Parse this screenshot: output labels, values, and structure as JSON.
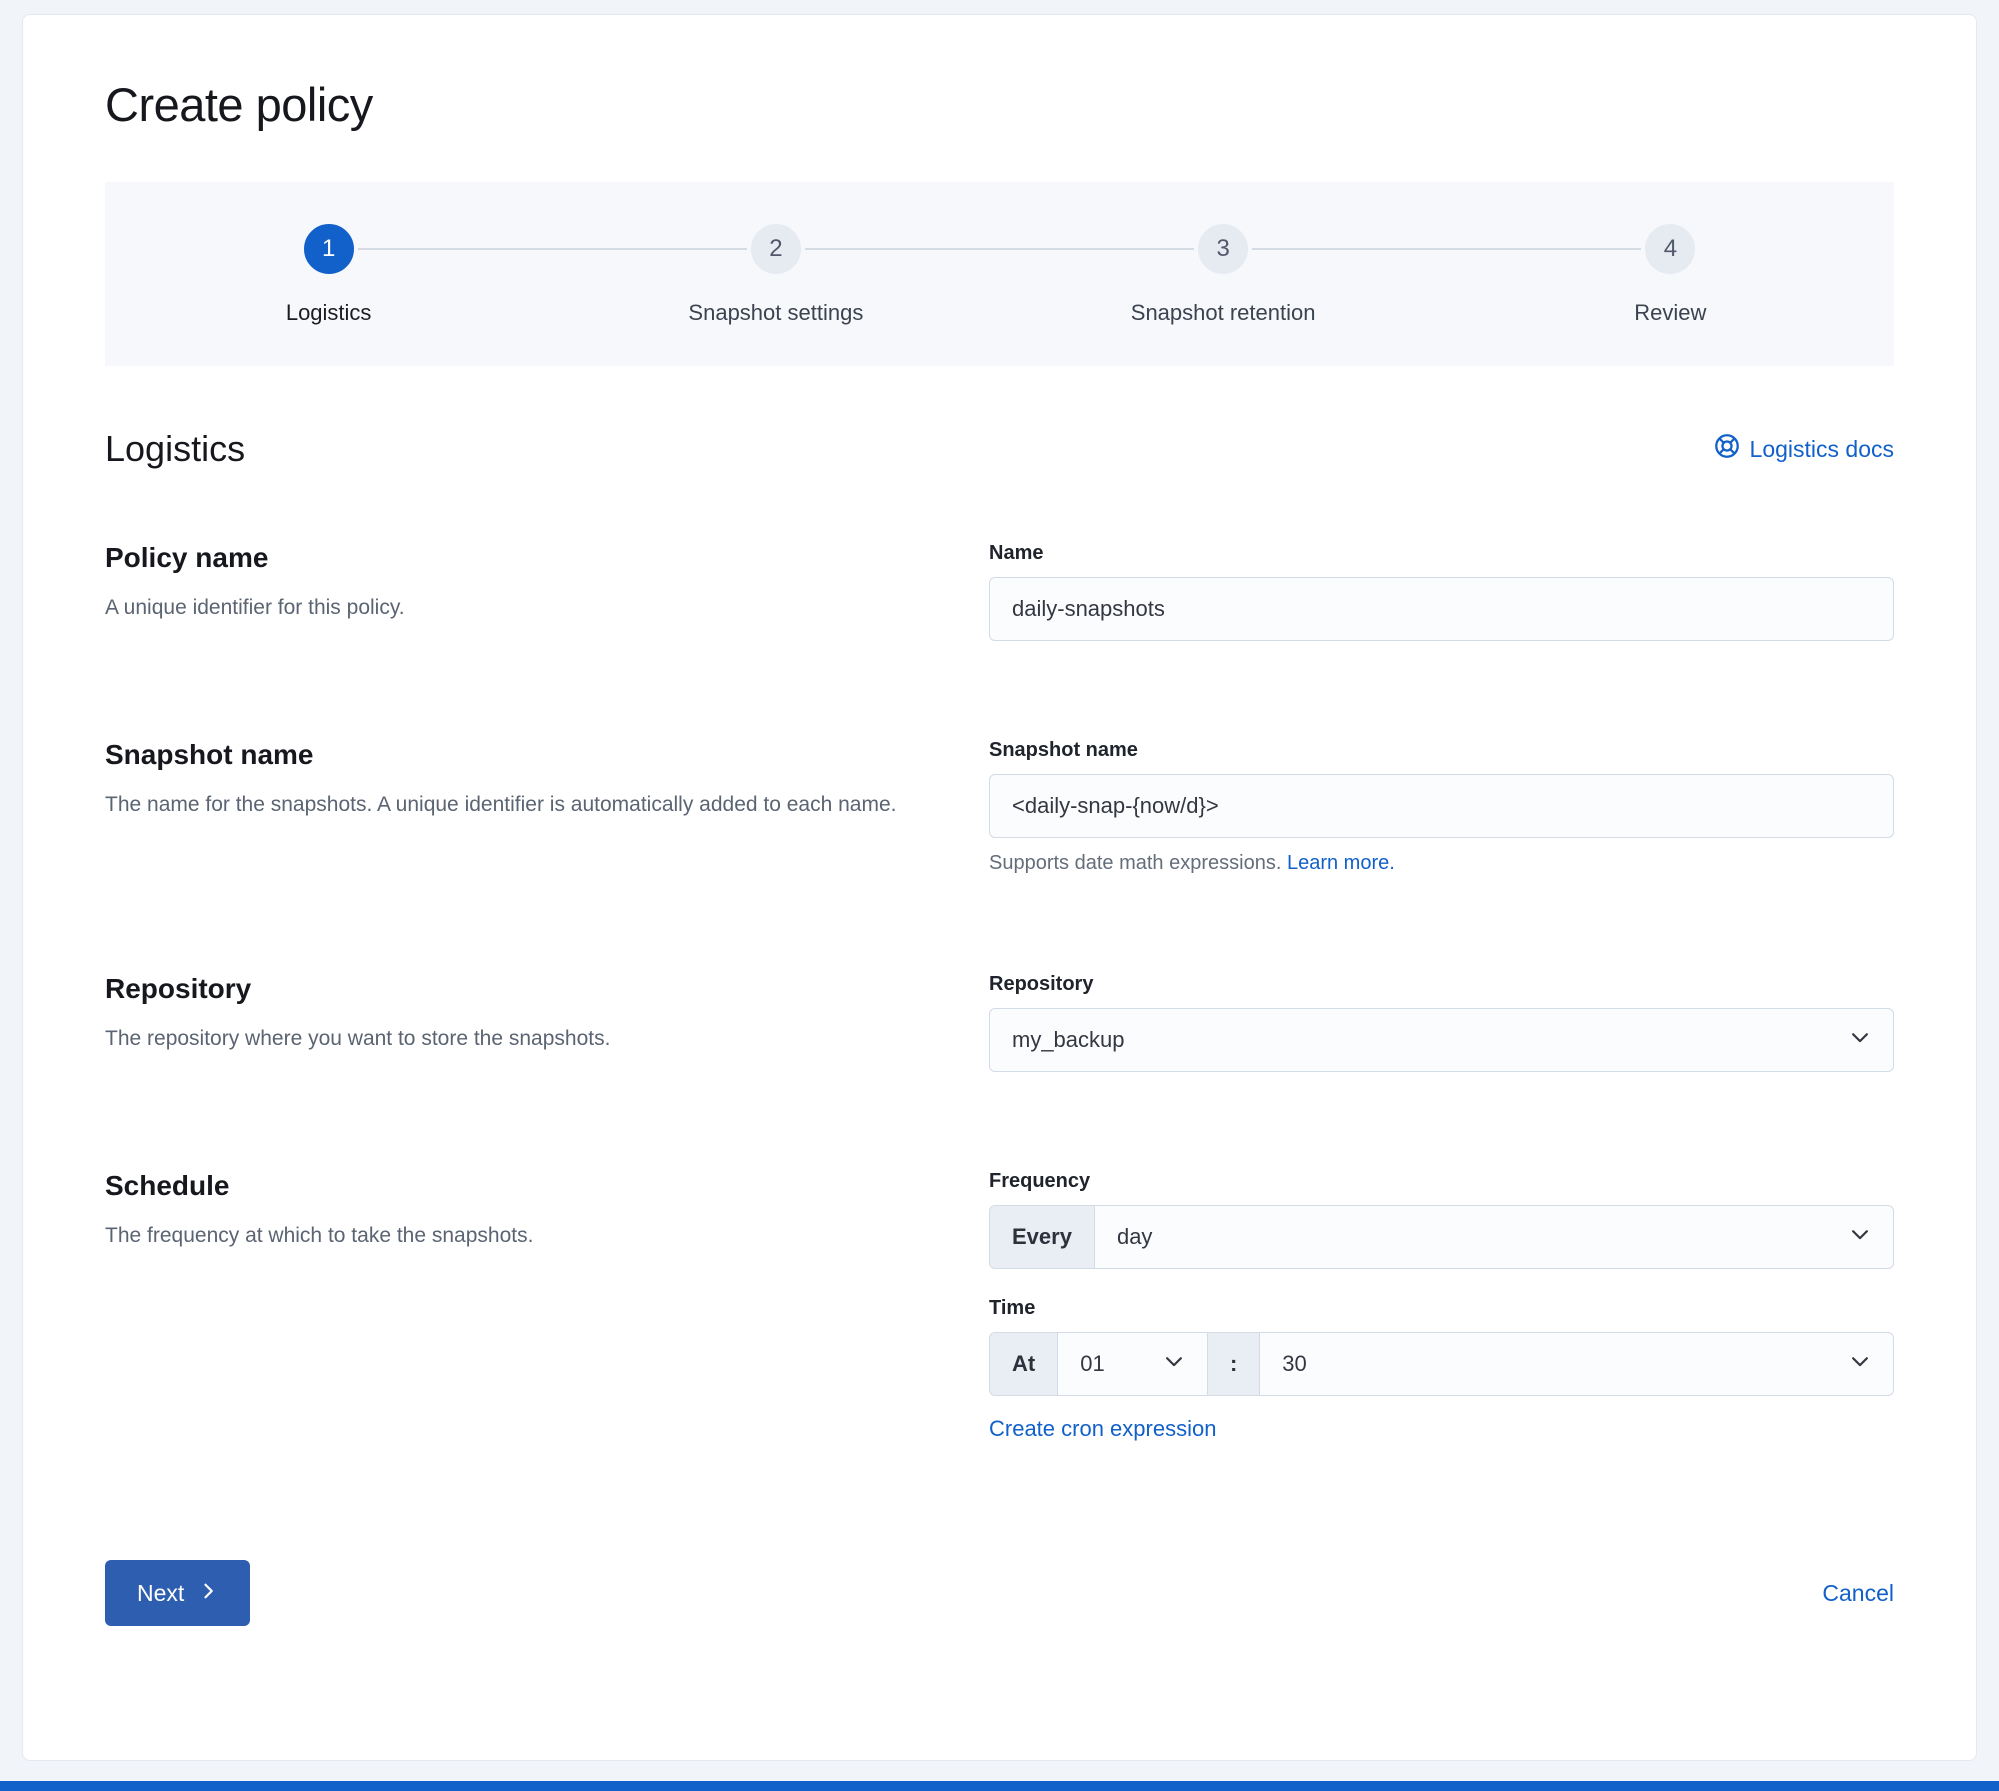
{
  "colors": {
    "accent": "#1260c9",
    "button": "#2e5eb0",
    "page_bg": "#f1f4f9"
  },
  "page": {
    "title": "Create policy"
  },
  "steps": [
    {
      "num": "1",
      "label": "Logistics",
      "state": "active"
    },
    {
      "num": "2",
      "label": "Snapshot settings",
      "state": "incomplete"
    },
    {
      "num": "3",
      "label": "Snapshot retention",
      "state": "incomplete"
    },
    {
      "num": "4",
      "label": "Review",
      "state": "incomplete"
    }
  ],
  "section": {
    "title": "Logistics",
    "docs_link": "Logistics docs"
  },
  "form": {
    "policy_name": {
      "heading": "Policy name",
      "description": "A unique identifier for this policy.",
      "label": "Name",
      "value": "daily-snapshots"
    },
    "snapshot_name": {
      "heading": "Snapshot name",
      "description": "The name for the snapshots. A unique identifier is automatically added to each name.",
      "label": "Snapshot name",
      "value": "<daily-snap-{now/d}>",
      "help": "Supports date math expressions.",
      "help_link": "Learn more."
    },
    "repository": {
      "heading": "Repository",
      "description": "The repository where you want to store the snapshots.",
      "label": "Repository",
      "value": "my_backup"
    },
    "schedule": {
      "heading": "Schedule",
      "description": "The frequency at which to take the snapshots.",
      "frequency_label": "Frequency",
      "frequency_prepend": "Every",
      "frequency_value": "day",
      "time_label": "Time",
      "time_prepend": "At",
      "hour_value": "01",
      "time_separator": ":",
      "minute_value": "30",
      "cron_link": "Create cron expression"
    }
  },
  "footer": {
    "next_label": "Next",
    "cancel_label": "Cancel"
  }
}
